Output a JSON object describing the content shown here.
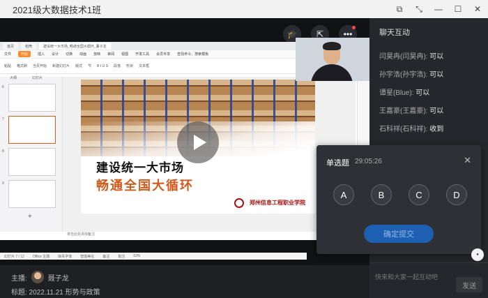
{
  "window": {
    "title": "2021级大数据技术1班"
  },
  "wps": {
    "tabs": [
      "首页",
      "稻壳",
      "建设统一大市场_畅通全国大循环_董子龙"
    ],
    "menu": [
      "文件",
      "开始",
      "插入",
      "设计",
      "切换",
      "动画",
      "放映",
      "审阅",
      "视图",
      "开发工具",
      "会员专享",
      "查找命令、搜索模板"
    ],
    "ribbon": [
      "粘贴",
      "格式刷",
      "当页开始",
      "新建幻灯片",
      "版式",
      "节",
      "B I U S",
      "段落",
      "形状",
      "文本框"
    ],
    "panel_tabs": [
      "大纲",
      "幻灯片"
    ],
    "slide_numbers": [
      "6",
      "7",
      "8",
      "9"
    ],
    "slide": {
      "title1": "建设统一大市场",
      "title2": "畅通全国大循环",
      "school": "郑州信息工程职业学院"
    },
    "notes": "单击此处添加备注",
    "status": [
      "幻灯片 7 / 12",
      "Office 主题",
      "缺失字体",
      "智能美化",
      "备注",
      "批注",
      "63%"
    ]
  },
  "bottom": {
    "anchor_label": "主播:",
    "anchor_name": "聂子龙",
    "subject": "标题: 2022.11.21 形势与政策"
  },
  "chat": {
    "title": "聊天互动",
    "messages": [
      {
        "user": "闫昊冉(闫昊冉):",
        "text": "可以"
      },
      {
        "user": "孙宇浩(孙宇浩):",
        "text": "可以"
      },
      {
        "user": "谭星(Blue):",
        "text": "可以"
      },
      {
        "user": "王嘉豪(王嘉豪):",
        "text": "可以"
      },
      {
        "user": "石科祥(石科祥):",
        "text": "收到"
      }
    ],
    "placeholder": "快来和大家一起互动吧",
    "send": "发送"
  },
  "quiz": {
    "title": "单选题",
    "time": "29:05:26",
    "options": [
      "A",
      "B",
      "C",
      "D"
    ],
    "submit": "确定提交"
  }
}
